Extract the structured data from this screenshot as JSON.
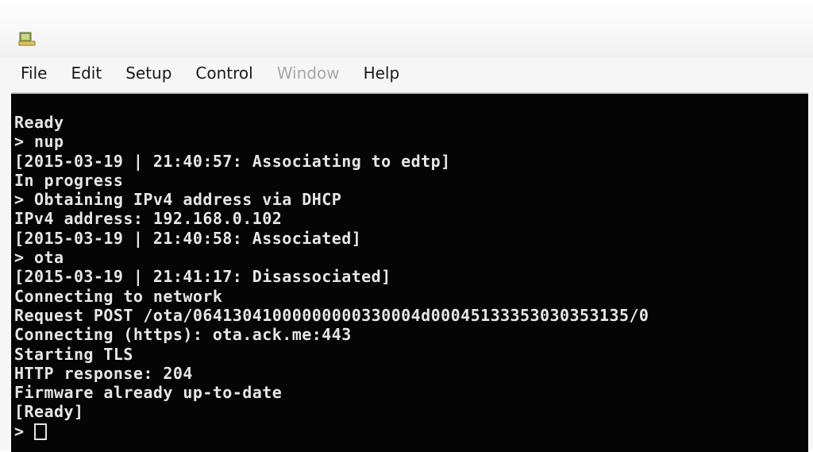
{
  "menu": {
    "items": [
      {
        "label": "File",
        "disabled": false
      },
      {
        "label": "Edit",
        "disabled": false
      },
      {
        "label": "Setup",
        "disabled": false
      },
      {
        "label": "Control",
        "disabled": false
      },
      {
        "label": "Window",
        "disabled": true
      },
      {
        "label": "Help",
        "disabled": false
      }
    ]
  },
  "terminal": {
    "lines": [
      "Ready",
      "> nup",
      "[2015-03-19 | 21:40:57: Associating to edtp]",
      "In progress",
      "> Obtaining IPv4 address via DHCP",
      "IPv4 address: 192.168.0.102",
      "[2015-03-19 | 21:40:58: Associated]",
      "> ota",
      "[2015-03-19 | 21:41:17: Disassociated]",
      "Connecting to network",
      "Request POST /ota/06413041000000000330004d00045133353030353135/0",
      "Connecting (https): ota.ack.me:443",
      "Starting TLS",
      "HTTP response: 204",
      "Firmware already up-to-date",
      "[Ready]"
    ],
    "prompt": ">"
  },
  "colors": {
    "terminal_bg": "#050505",
    "terminal_fg": "#e6e6e6",
    "menu_disabled": "#a8a8a8"
  }
}
